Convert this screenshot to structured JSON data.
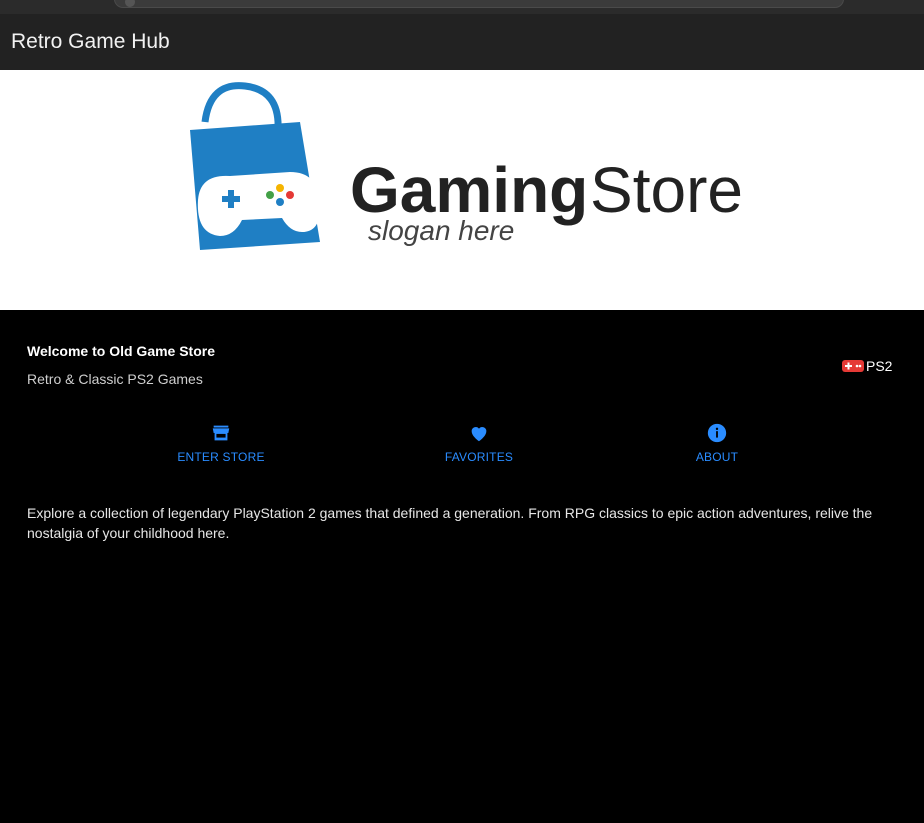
{
  "app": {
    "title": "Retro Game Hub"
  },
  "banner": {
    "logo_word_1": "Gaming",
    "logo_word_2": "Store",
    "logo_slogan": "slogan here"
  },
  "intro": {
    "welcome": "Welcome to Old Game Store",
    "subtitle": "Retro & Classic PS2 Games",
    "badge_label": "PS2",
    "badge_icon": "gamepad-icon"
  },
  "nav": {
    "items": [
      {
        "label": "ENTER STORE",
        "icon": "store-icon"
      },
      {
        "label": "FAVORITES",
        "icon": "heart-icon"
      },
      {
        "label": "ABOUT",
        "icon": "info-icon"
      }
    ]
  },
  "description": "Explore a collection of legendary PlayStation 2 games that defined a generation. From RPG classics to epic action adventures, relive the nostalgia of your childhood here.",
  "colors": {
    "accent": "#2a8cff",
    "appbar": "#222222",
    "background": "#000000",
    "badge": "#e53935",
    "logo_blue": "#1f7fc4",
    "logo_text": "#222222"
  }
}
